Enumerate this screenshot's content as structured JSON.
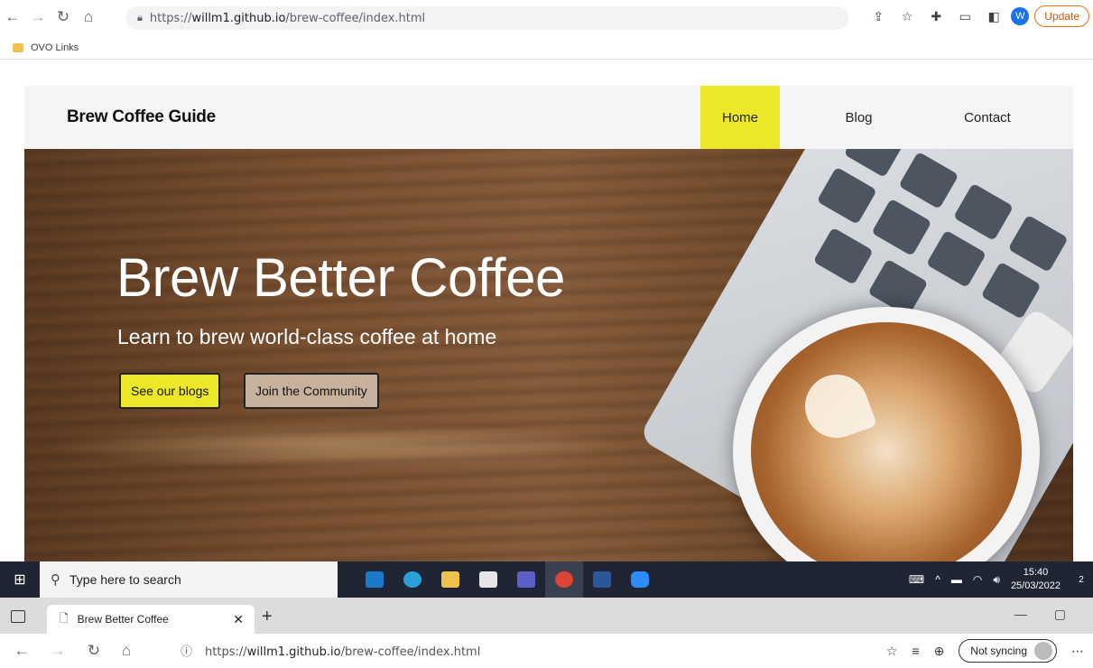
{
  "chrome": {
    "url_prefix": "https://",
    "url_host": "willm1.github.io",
    "url_path": "/brew-coffee/index.html",
    "avatar_letter": "W",
    "update_label": "Update",
    "bookmark_folder": "OVO Links"
  },
  "site": {
    "brand": "Brew Coffee Guide",
    "nav": {
      "home": "Home",
      "blog": "Blog",
      "contact": "Contact"
    },
    "hero": {
      "title": "Brew Better Coffee",
      "subtitle": "Learn to brew world-class coffee at home",
      "primary_button": "See our blogs",
      "secondary_button": "Join the Community"
    },
    "accent_color": "#ece829"
  },
  "taskbar": {
    "search_placeholder": "Type here to search",
    "time": "15:40",
    "date": "25/03/2022",
    "notification_count": "2"
  },
  "edge": {
    "tab_title": "Brew Better Coffee",
    "url_prefix": "https://",
    "url_host": "willm1.github.io",
    "url_path": "/brew-coffee/index.html",
    "sync_label": "Not syncing"
  }
}
